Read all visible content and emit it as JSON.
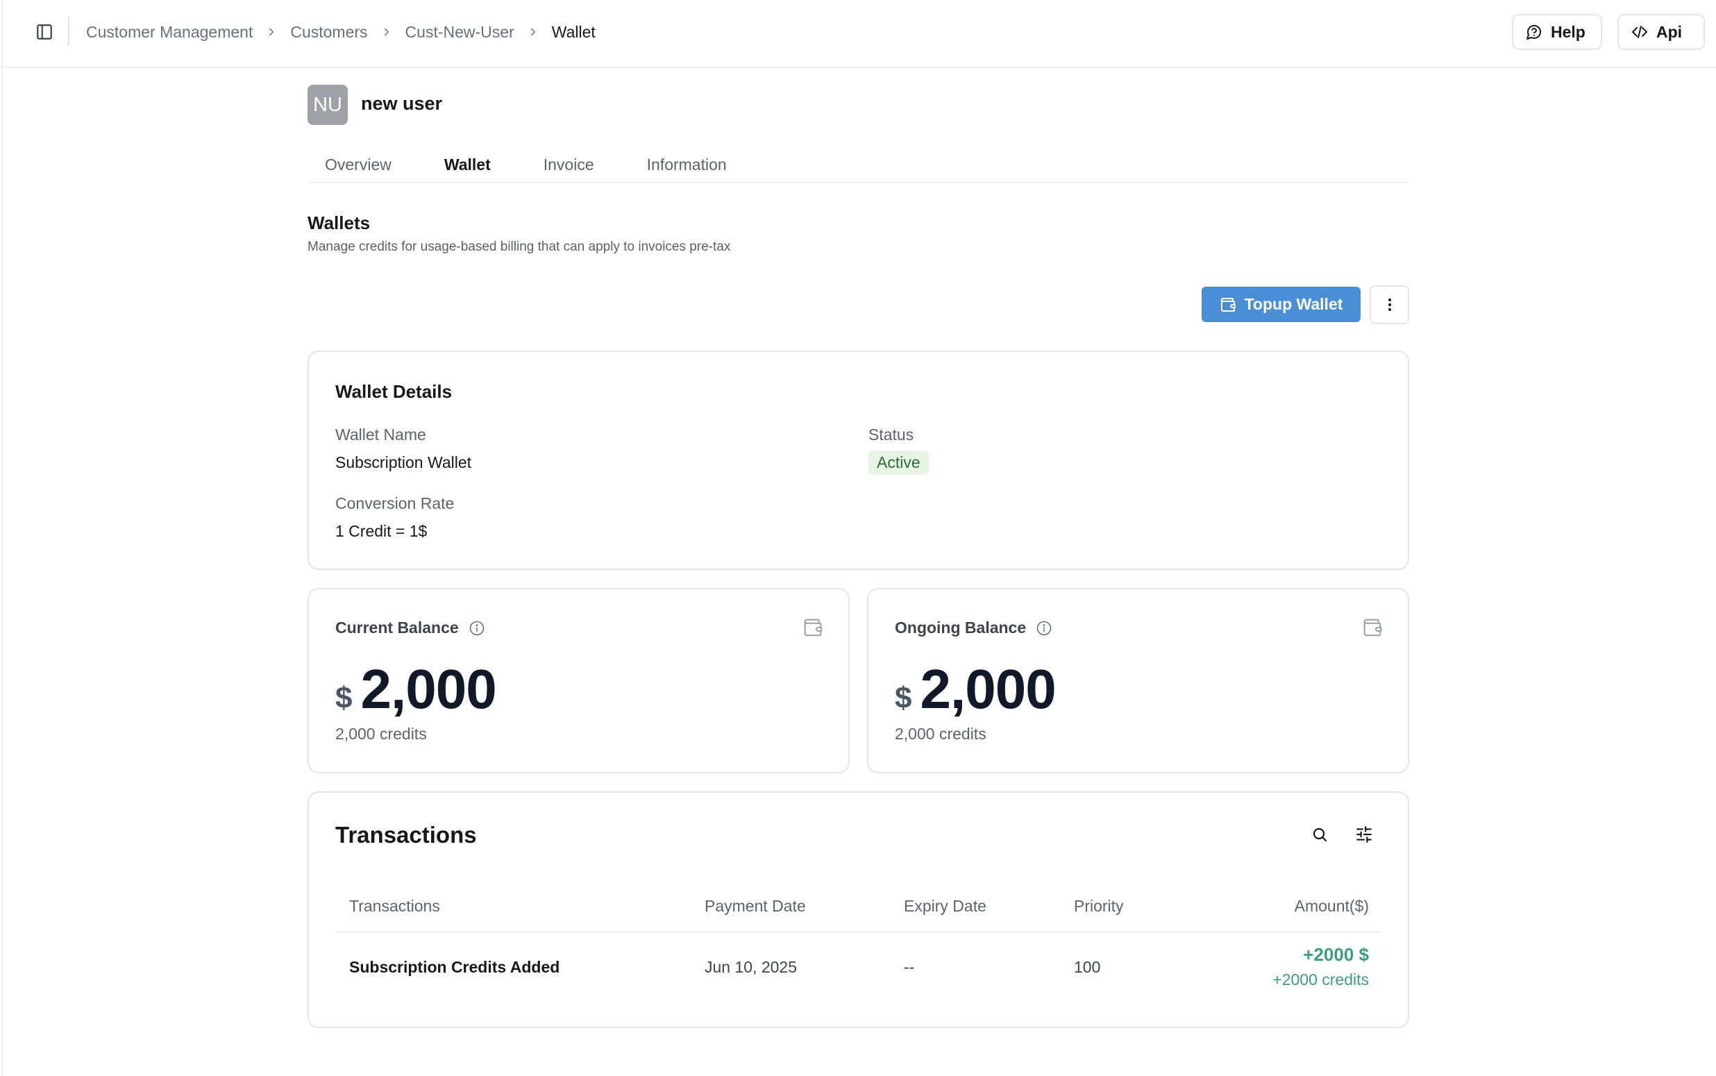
{
  "breadcrumb": [
    {
      "label": "Customer Management"
    },
    {
      "label": "Customers"
    },
    {
      "label": "Cust-New-User"
    },
    {
      "label": "Wallet"
    }
  ],
  "header": {
    "help_label": "Help",
    "api_label": "Api"
  },
  "customer": {
    "initials": "NU",
    "name": "new user"
  },
  "tabs": [
    {
      "label": "Overview",
      "active": false
    },
    {
      "label": "Wallet",
      "active": true
    },
    {
      "label": "Invoice",
      "active": false
    },
    {
      "label": "Information",
      "active": false
    }
  ],
  "wallets": {
    "title": "Wallets",
    "subtitle": "Manage credits for usage-based billing that can apply to invoices pre-tax",
    "topup_label": "Topup Wallet"
  },
  "wallet_details": {
    "title": "Wallet Details",
    "name_label": "Wallet Name",
    "name_value": "Subscription Wallet",
    "status_label": "Status",
    "status_value": "Active",
    "rate_label": "Conversion Rate",
    "rate_value": "1 Credit = 1$"
  },
  "current_balance": {
    "label": "Current Balance",
    "currency": "$",
    "amount": "2,000",
    "credits": "2,000 credits"
  },
  "ongoing_balance": {
    "label": "Ongoing Balance",
    "currency": "$",
    "amount": "2,000",
    "credits": "2,000 credits"
  },
  "transactions": {
    "title": "Transactions",
    "columns": {
      "transactions": "Transactions",
      "payment_date": "Payment Date",
      "expiry_date": "Expiry Date",
      "priority": "Priority",
      "amount": "Amount($)"
    },
    "rows": [
      {
        "name": "Subscription Credits Added",
        "payment_date": "Jun 10, 2025",
        "expiry_date": "--",
        "priority": "100",
        "amount": "+2000 $",
        "credits": "+2000 credits"
      }
    ]
  },
  "colors": {
    "primary": "#4a8fd6",
    "positive": "#3e9c86",
    "status_bg": "#e8f5e6"
  }
}
